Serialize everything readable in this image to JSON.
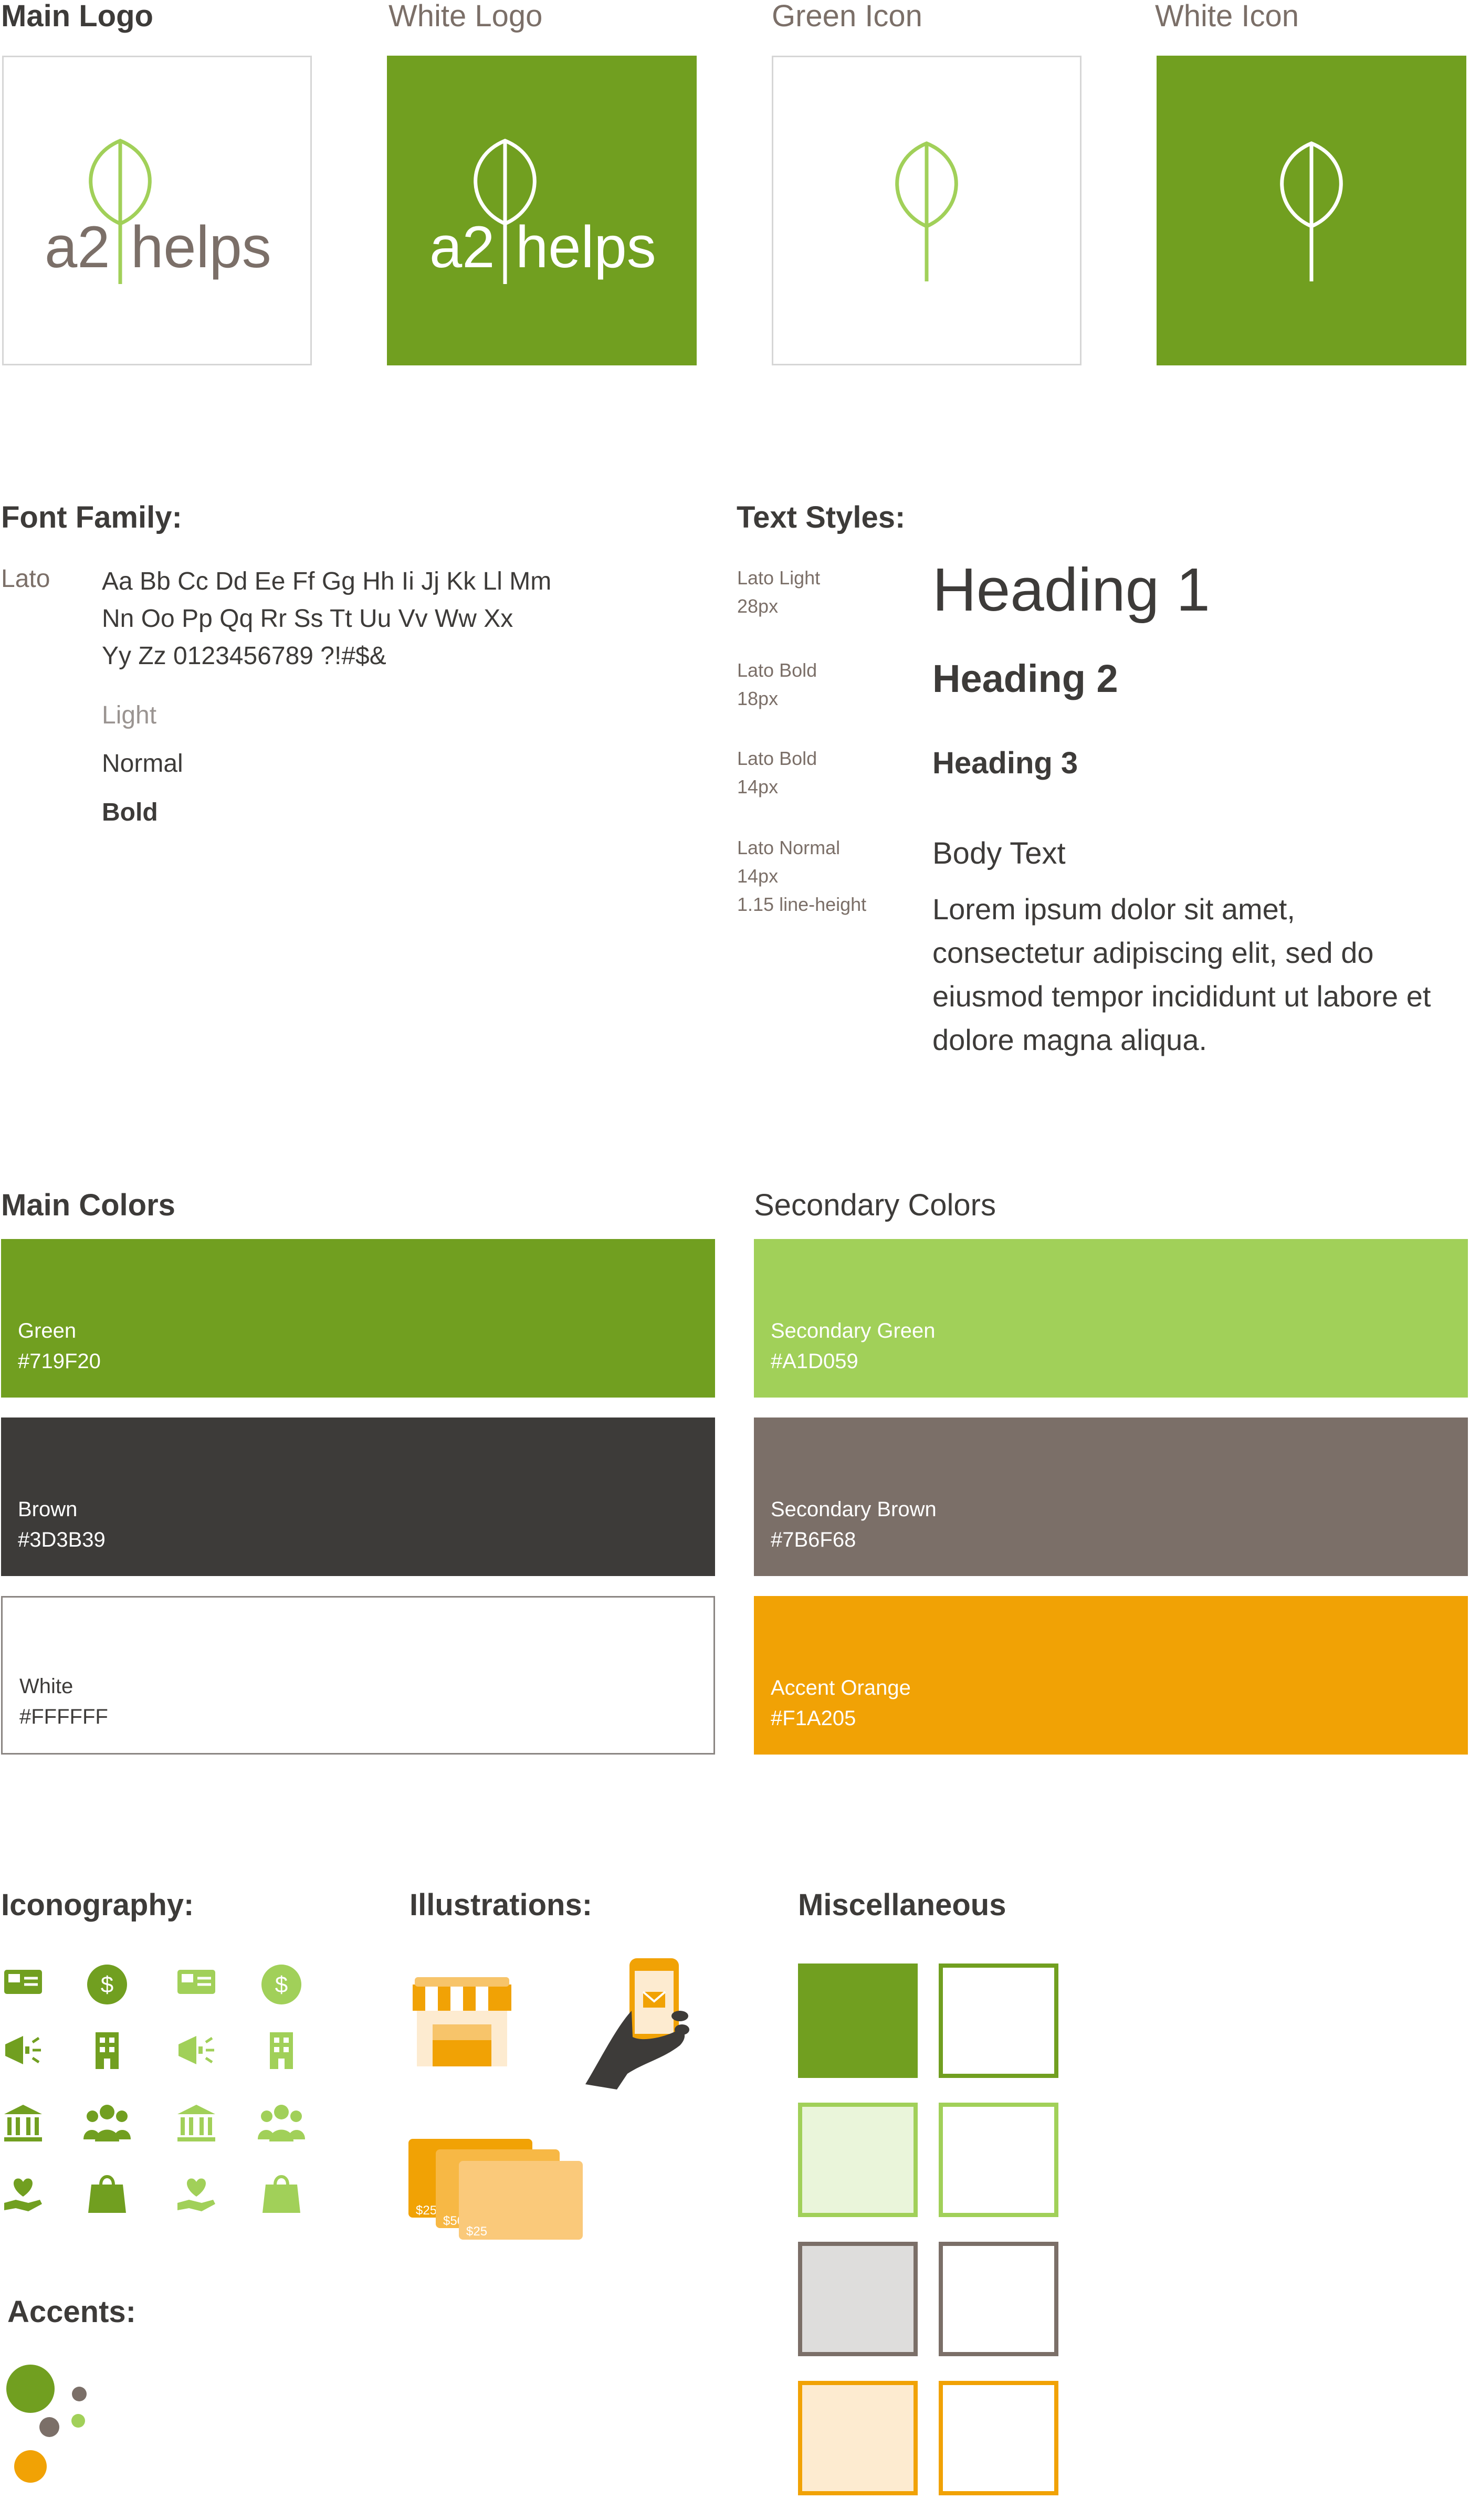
{
  "logos": {
    "main_title": "Main Logo",
    "white_title": "White Logo",
    "green_icon_title": "Green Icon",
    "white_icon_title": "White Icon",
    "wordmark_left": "a2",
    "wordmark_right": "helps"
  },
  "font_family": {
    "title": "Font Family:",
    "name": "Lato",
    "sample_lines": [
      "Aa Bb Cc Dd Ee Ff Gg Hh Ii Jj Kk Ll Mm",
      "Nn Oo Pp Qq Rr Ss Tt Uu Vv Ww Xx",
      "Yy Zz 0123456789 ?!#$&"
    ],
    "weights": [
      "Light",
      "Normal",
      "Bold"
    ]
  },
  "text_styles": {
    "title": "Text Styles:",
    "items": [
      {
        "meta": [
          "Lato Light",
          "28px"
        ],
        "sample": "Heading 1"
      },
      {
        "meta": [
          "Lato Bold",
          "18px"
        ],
        "sample": "Heading 2"
      },
      {
        "meta": [
          "Lato Bold",
          "14px"
        ],
        "sample": "Heading 3"
      },
      {
        "meta": [
          "Lato Normal",
          "14px",
          "1.15 line-height"
        ],
        "sample": "Body Text"
      }
    ],
    "body_sample": "Lorem ipsum dolor sit amet, consectetur adipiscing elit, sed do eiusmod tempor incididunt ut labore et dolore magna aliqua."
  },
  "main_colors": {
    "title": "Main Colors",
    "swatches": [
      {
        "name": "Green",
        "hex": "#719F20"
      },
      {
        "name": "Brown",
        "hex": "#3D3B39"
      },
      {
        "name": "White",
        "hex": "#FFFFFF"
      }
    ]
  },
  "secondary_colors": {
    "title": "Secondary Colors",
    "swatches": [
      {
        "name": "Secondary Green",
        "hex": "#A1D059"
      },
      {
        "name": "Secondary Brown",
        "hex": "#7B6F68"
      },
      {
        "name": "Accent Orange",
        "hex": "#F1A205"
      }
    ]
  },
  "iconography": {
    "title": "Iconography:",
    "icons": [
      "gift-card-icon",
      "dollar-coin-icon",
      "megaphone-icon",
      "building-icon",
      "bank-icon",
      "people-icon",
      "heart-hand-icon",
      "shopping-bag-icon"
    ]
  },
  "illustrations": {
    "title": "Illustrations:",
    "card_values": [
      "$25",
      "$50",
      "$25"
    ]
  },
  "miscellaneous": {
    "title": "Miscellaneous"
  },
  "accents": {
    "title": "Accents:"
  },
  "colors": {
    "green": "#719F20",
    "secondary_green": "#A1D059",
    "brown": "#3D3B39",
    "secondary_brown": "#7B6F68",
    "orange": "#F1A205",
    "white": "#FFFFFF"
  }
}
